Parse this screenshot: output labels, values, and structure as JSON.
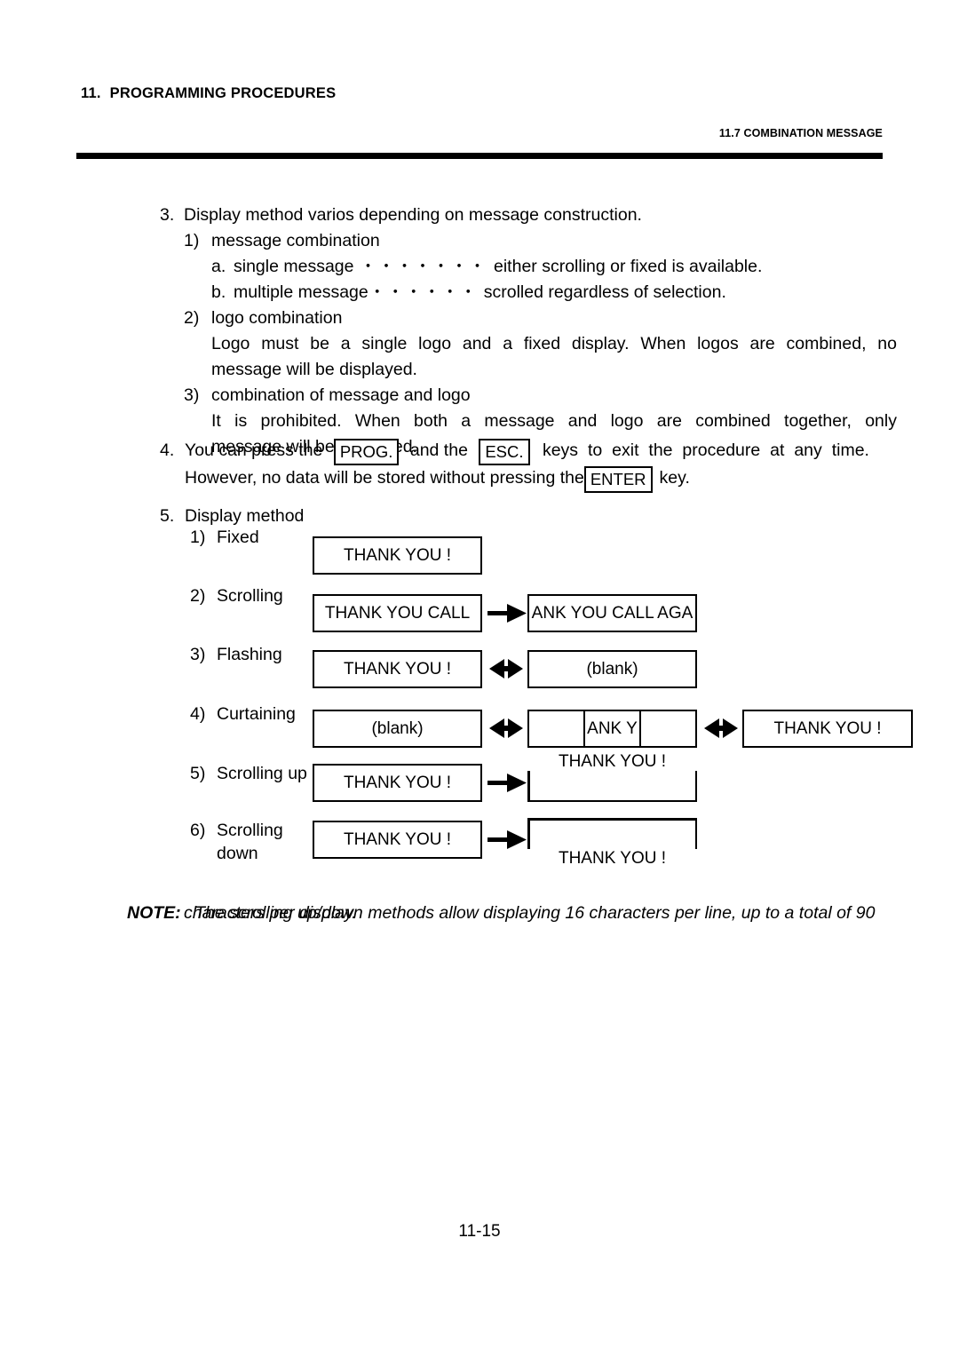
{
  "header": {
    "chapter_number": "11.",
    "chapter_title": "PROGRAMMING PROCEDURES",
    "section_title": "11.7 COMBINATION MESSAGE"
  },
  "item3": {
    "marker": "3.",
    "heading": "Display method varios depending on message construction.",
    "sub1": {
      "marker": "1)",
      "title": "message combination",
      "a_marker": "a.",
      "a_label": "single message",
      "a_dots": "・・・・・・・",
      "a_text": "either scrolling or fixed is available.",
      "b_marker": "b.",
      "b_label": "multiple message",
      "b_dots": "・・・・・・",
      "b_text": "scrolled regardless of selection."
    },
    "sub2": {
      "marker": "2)",
      "title": "logo combination",
      "line1": "Logo must be a single logo and a fixed display.  When logos are combined, no",
      "line2": "message will be displayed."
    },
    "sub3": {
      "marker": "3)",
      "title": "combination of message and logo",
      "line1": "It is prohibited.  When both a message and logo are combined together, only",
      "line2": "message will be displayed."
    }
  },
  "item4": {
    "marker": "4.",
    "line1_part1": "You can press the",
    "key_prog": "PROG.",
    "line1_part2": "and the",
    "key_esc": "ESC.",
    "line1_part3": "keys to exit the procedure at any time.",
    "line2_part1": "However, no data will be stored without pressing the",
    "key_enter": "ENTER",
    "line2_part2": "key."
  },
  "item5": {
    "marker": "5.",
    "title": "Display method",
    "methods": [
      {
        "number": "1)",
        "label": "Fixed"
      },
      {
        "number": "2)",
        "label": "Scrolling"
      },
      {
        "number": "3)",
        "label": "Flashing"
      },
      {
        "number": "4)",
        "label": "Curtaining"
      },
      {
        "number": "5)",
        "label": "Scrolling up"
      },
      {
        "number": "6)",
        "label": "Scrolling",
        "label2": "down"
      }
    ],
    "displays": {
      "fixed": "THANK YOU !",
      "scrolling_1": "THANK YOU CALL",
      "scrolling_2": "ANK YOU CALL AGA",
      "flashing_1": "THANK YOU !",
      "flashing_2": "(blank)",
      "curtaining_1": "(blank)",
      "curtaining_2": "ANK Y",
      "curtaining_3": "THANK YOU !",
      "scrolling_up_1": "THANK YOU !",
      "scrolling_up_2": "THANK YOU !",
      "scrolling_down_1": "THANK YOU !",
      "scrolling_down_2": "THANK YOU !"
    }
  },
  "note": {
    "label": "NOTE:",
    "line1": "The scrolling up/down methods allow displaying 16 characters per line, up to a total of 90",
    "line2": "characters per display."
  },
  "footer": {
    "page_number": "11-15"
  }
}
